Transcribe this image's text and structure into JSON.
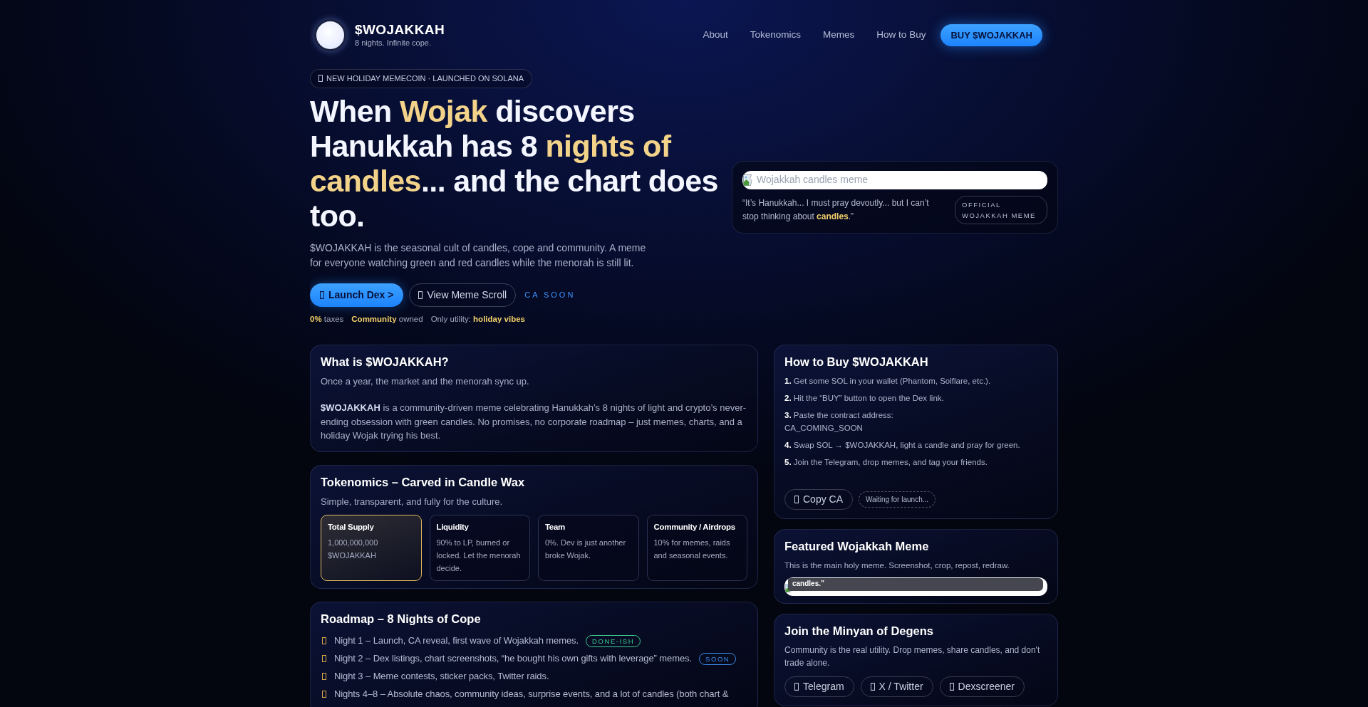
{
  "header": {
    "brand": "$WOJAKKAH",
    "tagline": "8 nights. Infinite cope.",
    "nav": [
      "About",
      "Tokenomics",
      "Memes",
      "How to Buy"
    ],
    "cta": "BUY $WOJAKKAH"
  },
  "hero": {
    "badge": "NEW HOLIDAY MEMECOIN · LAUNCHED ON SOLANA",
    "heading": [
      {
        "text": "When ",
        "accent": false
      },
      {
        "text": "Wojak",
        "accent": true
      },
      {
        "text": " discovers Hanukkah has 8 ",
        "accent": false
      },
      {
        "text": "nights of candles",
        "accent": true
      },
      {
        "text": "... and the chart does too.",
        "accent": false
      }
    ],
    "intro": "$WOJAKKAH is the seasonal cult of candles, cope and community. A meme for everyone watching green and red candles while the menorah is still lit.",
    "buttons": [
      {
        "label": "Launch Dex >",
        "kind": "primary"
      },
      {
        "label": "View Meme Scroll",
        "kind": "outline"
      }
    ],
    "ca_status": "CA SOON",
    "stats": [
      "**0%** taxes",
      "**Community** owned",
      "Only utility: **holiday vibes**"
    ],
    "meme_card": {
      "image_alt": "Wojakkah candles meme",
      "quote": "“It’s Hanukkah... I must pray devoutly... but I can’t stop thinking about **candles**.”",
      "tag": "OFFICIAL WOJAKKAH MEME"
    }
  },
  "about": {
    "title": "What is $WOJAKKAH?",
    "lead": "Once a year, the market and the menorah sync up.",
    "body": "**$WOJAKKAH** is a community-driven meme celebrating Hanukkah’s 8 nights of light and crypto’s never-ending obsession with green candles. No promises, no corporate roadmap – just memes, charts, and a holiday Wojak trying his best."
  },
  "tokenomics": {
    "title": "Tokenomics – Carved in Candle Wax",
    "subtitle": "Simple, transparent, and fully for the culture.",
    "tiles": [
      {
        "title": "Total Supply",
        "text": "1,000,000,000 $WOJAKKAH",
        "highlighted": true
      },
      {
        "title": "Liquidity",
        "text": "90% to LP, burned or locked. Let the menorah decide.",
        "highlighted": false
      },
      {
        "title": "Team",
        "text": "0%. Dev is just another broke Wojak.",
        "highlighted": false
      },
      {
        "title": "Community / Airdrops",
        "text": "10% for memes, raids and seasonal events.",
        "highlighted": false
      }
    ]
  },
  "roadmap": {
    "title": "Roadmap – 8 Nights of Cope",
    "items": [
      {
        "text": "Night 1 – Launch, CA reveal, first wave of Wojakkah memes.",
        "tag": {
          "text": "DONE-ISH",
          "color": "#3ccf91"
        }
      },
      {
        "text": "Night 2 – Dex listings, chart screenshots, “he bought his own gifts with leverage” memes.",
        "tag": {
          "text": "SOON",
          "color": "#3b8df0"
        }
      },
      {
        "text": "Night 3 – Meme contests, sticker packs, Twitter raids."
      },
      {
        "text": "Nights 4–8 – Absolute chaos, community ideas, surprise events, and a lot of candles (both chart &"
      }
    ]
  },
  "how_to_buy": {
    "title": "How to Buy $WOJAKKAH",
    "steps": [
      {
        "text": "**1.** Get some SOL in your wallet (Phantom, Solflare, etc.)."
      },
      {
        "text": "**2.** Hit the “BUY” button to open the Dex link."
      },
      {
        "text": "**3.** Paste the contract address:",
        "detail": "CA_COMING_SOON"
      },
      {
        "text": "**4.** Swap SOL → $WOJAKKAH, light a candle and pray for green."
      },
      {
        "text": "**5.** Join the Telegram, drop memes, and tag your friends."
      }
    ],
    "copy_button": "Copy CA",
    "status": "Waiting for launch..."
  },
  "featured": {
    "title": "Featured Wojakkah Meme",
    "text": "This is the main holy meme. Screenshot, crop, repost, redraw.",
    "image_caption": "candles.”"
  },
  "community": {
    "title": "Join the Minyan of Degens",
    "text": "Community is the real utility. Drop memes, share candles, and don't trade alone.",
    "links": [
      "Telegram",
      "X / Twitter",
      "Dexscreener"
    ]
  }
}
